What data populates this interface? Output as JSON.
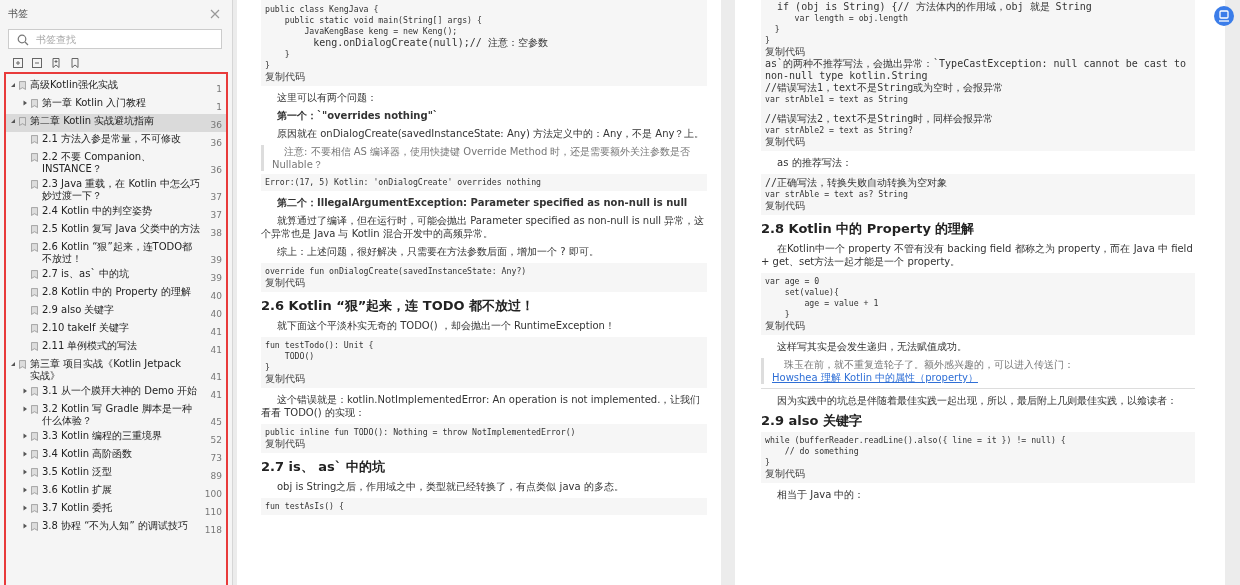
{
  "sidebar": {
    "title": "书签",
    "search": {
      "placeholder": "书签查找"
    },
    "bookmarks": [
      {
        "title": "高级Kotlin强化实战",
        "page": "1",
        "expanded": true,
        "selected": false,
        "children": [
          {
            "title": "第一章 Kotlin 入门教程",
            "page": "1",
            "expanded": false,
            "selected": false
          }
        ]
      },
      {
        "title": "第二章 Kotlin 实战避坑指南",
        "page": "36",
        "expanded": true,
        "selected": true,
        "children": [
          {
            "title": "2.1 方法入参是常量，不可修改",
            "page": "36",
            "selected": false
          },
          {
            "title": "2.2 不要 Companion、INSTANCE？",
            "page": "36",
            "selected": false
          },
          {
            "title": "2.3 Java 重载，在 Kotlin 中怎么巧妙过渡一下？",
            "page": "37",
            "selected": false
          },
          {
            "title": "2.4 Kotlin 中的判空姿势",
            "page": "37",
            "selected": false
          },
          {
            "title": "2.5 Kotlin 复写 Java 父类中的方法",
            "page": "38",
            "selected": false
          },
          {
            "title": "2.6 Kotlin “狠”起来，连TODO都不放过！",
            "page": "39",
            "selected": false
          },
          {
            "title": "2.7 is、as` 中的坑",
            "page": "39",
            "selected": false
          },
          {
            "title": "2.8 Kotlin 中的 Property 的理解",
            "page": "40",
            "selected": false
          },
          {
            "title": "2.9 also 关键字",
            "page": "40",
            "selected": false
          },
          {
            "title": "2.10 takeIf 关键字",
            "page": "41",
            "selected": false
          },
          {
            "title": "2.11 单例模式的写法",
            "page": "41",
            "selected": false
          }
        ]
      },
      {
        "title": "第三章 项目实战《Kotlin Jetpack 实战》",
        "page": "41",
        "expanded": true,
        "selected": false,
        "children": [
          {
            "title": "3.1 从一个膜拜大神的 Demo 开始",
            "page": "41",
            "expanded": false,
            "selected": false
          },
          {
            "title": "3.2 Kotlin 写 Gradle 脚本是一种什么体验？",
            "page": "45",
            "expanded": false,
            "selected": false
          },
          {
            "title": "3.3 Kotlin 编程的三重境界",
            "page": "52",
            "expanded": false,
            "selected": false
          },
          {
            "title": "3.4  Kotlin 高阶函数",
            "page": "73",
            "expanded": false,
            "selected": false
          },
          {
            "title": "3.5 Kotlin 泛型",
            "page": "89",
            "expanded": false,
            "selected": false
          },
          {
            "title": "3.6 Kotlin 扩展",
            "page": "100",
            "expanded": false,
            "selected": false
          },
          {
            "title": "3.7 Kotlin 委托",
            "page": "110",
            "expanded": false,
            "selected": false
          },
          {
            "title": "3.8 协程 “不为人知” 的调试技巧",
            "page": "118",
            "expanded": false,
            "selected": false
          }
        ]
      }
    ]
  },
  "pages": [
    {
      "blocks": [
        {
          "kind": "code",
          "segments": [
            {
              "lines": [
                "public class KengJava {",
                "    public static void main(String[] args) {",
                "        JavaKengBase keng = new Keng();",
                "        keng.onDialogCreate(null);// 注意：空参数",
                "    }",
                "}"
              ],
              "copy": "复制代码"
            }
          ]
        },
        {
          "kind": "para",
          "text": "这里可以有两个问题："
        },
        {
          "kind": "bold",
          "text": "第一个：`\"overrides nothing\"`"
        },
        {
          "kind": "para",
          "text": "原因就在 onDialogCreate(savedInstanceState: Any) 方法定义中的：Any，不是 Any？上。"
        },
        {
          "kind": "quote",
          "text": "注意: 不要相信 AS 编译器，使用快捷键 Override Method 时，还是需要额外关注参数是否 Nullable？"
        },
        {
          "kind": "code",
          "segments": [
            {
              "lines": [
                "Error:(17, 5) Kotlin: 'onDialogCreate' overrides nothing"
              ]
            }
          ]
        },
        {
          "kind": "bold",
          "text": "第二个：IllegalArgumentException: Parameter specified as non-null is null"
        },
        {
          "kind": "para",
          "text": "就算通过了编译，但在运行时，可能会抛出 Parameter specified as non-null is null 异常，这个异常也是 Java 与 Kotlin 混合开发中的高频异常。"
        },
        {
          "kind": "para",
          "text": "综上：上述问题，很好解决，只需要在方法参数后面，增加一个 ? 即可。"
        },
        {
          "kind": "code",
          "segments": [
            {
              "lines": [
                "override fun onDialogCreate(savedInstanceState: Any?)"
              ],
              "copy": "复制代码"
            }
          ]
        },
        {
          "kind": "heading",
          "text": "2.6 Kotlin “狠”起来，连 TODO 都不放过！"
        },
        {
          "kind": "para",
          "text": "就下面这个平淡朴实无奇的 TODO() ，却会抛出一个 RuntimeException！"
        },
        {
          "kind": "code",
          "segments": [
            {
              "lines": [
                "fun testTodo(): Unit {",
                "    TODO()",
                "}"
              ],
              "copy": "复制代码"
            }
          ]
        },
        {
          "kind": "para",
          "text": "这个错误就是：kotlin.NotImplementedError: An operation is not implemented.，让我们看看 TODO() 的实现："
        },
        {
          "kind": "code",
          "segments": [
            {
              "lines": [
                "public inline fun TODO(): Nothing = throw NotImplementedError()"
              ],
              "copy": "复制代码"
            }
          ]
        },
        {
          "kind": "heading",
          "text": "2.7 is、 as` 中的坑"
        },
        {
          "kind": "para",
          "text": "obj is String之后，作用域之中，类型就已经转换了，有点类似 java 的多态。"
        },
        {
          "kind": "code",
          "segments": [
            {
              "lines": [
                "fun testAsIs() {"
              ]
            }
          ]
        }
      ]
    },
    {
      "blocks": [
        {
          "kind": "code",
          "segments": [
            {
              "lines": [
                "  if (obj is String) {// 方法体内的作用域，obj 就是 String",
                "      var length = obj.length",
                "  }",
                "}"
              ],
              "copy": "复制代码"
            },
            {
              "lines": [
                "as`的两种不推荐写法，会抛出异常：`TypeCastException: null cannot be cast to non-null type kotlin.String",
                "//错误写法1，text不是String或为空时，会报异常",
                "var strAble1 = text as String"
              ]
            },
            {
              "lines": [
                "//错误写法2，text不是String时，同样会报异常",
                "var strAble2 = text as String?"
              ],
              "copy": "复制代码"
            }
          ]
        },
        {
          "kind": "para",
          "text": "as 的推荐写法："
        },
        {
          "kind": "code",
          "segments": [
            {
              "lines": [
                "//正确写法，转换失败自动转换为空对象",
                "var strAble = text as? String"
              ],
              "copy": "复制代码"
            }
          ]
        },
        {
          "kind": "heading",
          "text": "2.8 Kotlin 中的 Property 的理解"
        },
        {
          "kind": "para",
          "text": "在Kotlin中一个 property 不管有没有 backing field 都称之为 property，而在 Java 中 field + get、set方法一起才能是一个 property。"
        },
        {
          "kind": "code",
          "segments": [
            {
              "lines": [
                "var age = 0",
                "    set(value){",
                "        age = value + 1",
                "    }"
              ],
              "copy": "复制代码"
            }
          ]
        },
        {
          "kind": "para",
          "text": "这样写其实是会发生递归，无法赋值成功。"
        },
        {
          "kind": "quote",
          "text": "珠玉在前，就不重复造轮子了。额外感兴趣的，可以进入传送门：",
          "link": "Howshea 理解 Kotlin 中的属性（property）"
        },
        {
          "kind": "rule"
        },
        {
          "kind": "para",
          "text": "因为实践中的坑总是伴随着最佳实践一起出现，所以，最后附上几则最佳实践，以飨读者："
        },
        {
          "kind": "heading",
          "text": "2.9 also 关键字"
        },
        {
          "kind": "code",
          "segments": [
            {
              "lines": [
                "while (bufferReader.readLine().also({ line = it }) != null) {",
                "    // do something",
                "}"
              ],
              "copy": "复制代码"
            }
          ]
        },
        {
          "kind": "para",
          "text": "相当于 Java 中的："
        }
      ]
    }
  ]
}
